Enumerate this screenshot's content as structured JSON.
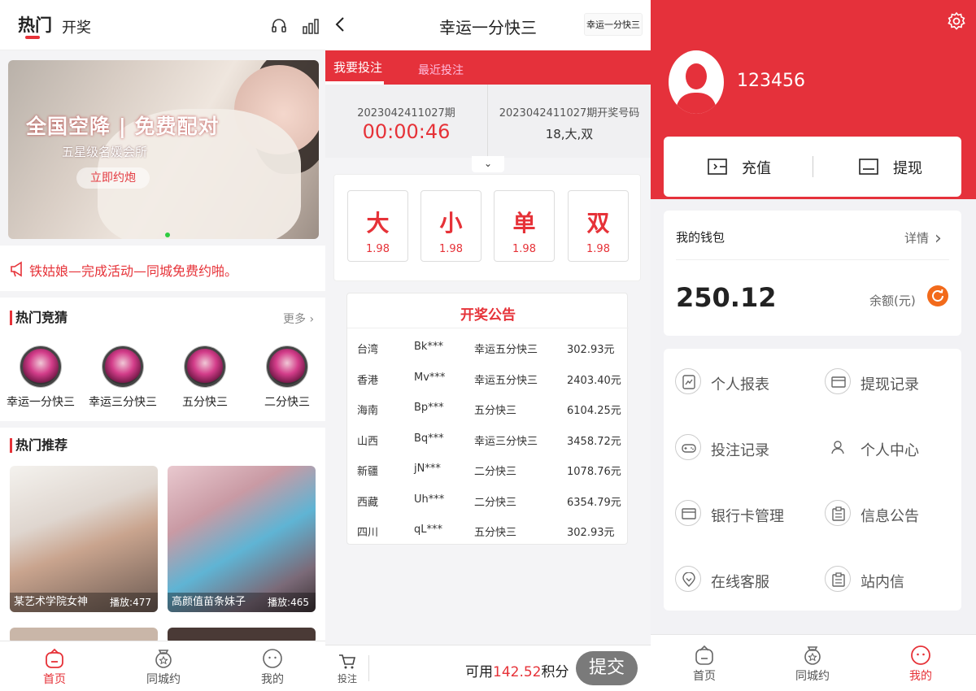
{
  "panel1": {
    "tabs": [
      "热门",
      "开奖"
    ],
    "banner": {
      "title": "全国空降 | 免费配对",
      "subtitle": "五星级名媛会所",
      "button": "立即约炮"
    },
    "notice": "铁姑娘—完成活动—同城免费约啪。",
    "hot_games": {
      "title": "热门竞猜",
      "more": "更多",
      "items": [
        "幸运一分快三",
        "幸运三分快三",
        "五分快三",
        "二分快三"
      ]
    },
    "recommend": {
      "title": "热门推荐",
      "items": [
        {
          "caption": "某艺术学院女神",
          "plays": "播放:477"
        },
        {
          "caption": "高颜值苗条妹子",
          "plays": "播放:465"
        }
      ]
    },
    "tabbar": [
      "首页",
      "同城约",
      "我的"
    ]
  },
  "panel2": {
    "title": "幸运一分快三",
    "chip": "幸运一分快三",
    "tabs": [
      "我要投注",
      "最近投注"
    ],
    "issue": {
      "current": "2023042411027期",
      "countdown": "00:00:46",
      "prev_label": "2023042411027期开奖号码",
      "prev_result": "18,大,双"
    },
    "bets": [
      {
        "name": "大",
        "odds": "1.98"
      },
      {
        "name": "小",
        "odds": "1.98"
      },
      {
        "name": "单",
        "odds": "1.98"
      },
      {
        "name": "双",
        "odds": "1.98"
      }
    ],
    "lottery": {
      "title": "开奖公告",
      "rows": [
        [
          "台湾",
          "Bk***",
          "幸运五分快三",
          "302.93元"
        ],
        [
          "香港",
          "Mv***",
          "幸运五分快三",
          "2403.40元"
        ],
        [
          "海南",
          "Bp***",
          "五分快三",
          "6104.25元"
        ],
        [
          "山西",
          "Bq***",
          "幸运三分快三",
          "3458.72元"
        ],
        [
          "新疆",
          "jN***",
          "二分快三",
          "1078.76元"
        ],
        [
          "西藏",
          "Uh***",
          "二分快三",
          "6354.79元"
        ],
        [
          "四川",
          "qL***",
          "五分快三",
          "302.93元"
        ]
      ]
    },
    "bottom": {
      "bet_label": "投注",
      "available_prefix": "可用",
      "points": "142.52",
      "available_suffix": "积分",
      "submit": "提交"
    }
  },
  "panel3": {
    "username": "123456",
    "recharge": "充值",
    "withdraw": "提现",
    "wallet": {
      "title": "我的钱包",
      "detail": "详情",
      "amount": "250.12",
      "unit": "余额(元)"
    },
    "menu": [
      "个人报表",
      "提现记录",
      "投注记录",
      "个人中心",
      "银行卡管理",
      "信息公告",
      "在线客服",
      "站内信"
    ],
    "tabbar": [
      "首页",
      "同城约",
      "我的"
    ]
  },
  "colors": {
    "accent": "#e5313b",
    "orange": "#f26a1b"
  }
}
